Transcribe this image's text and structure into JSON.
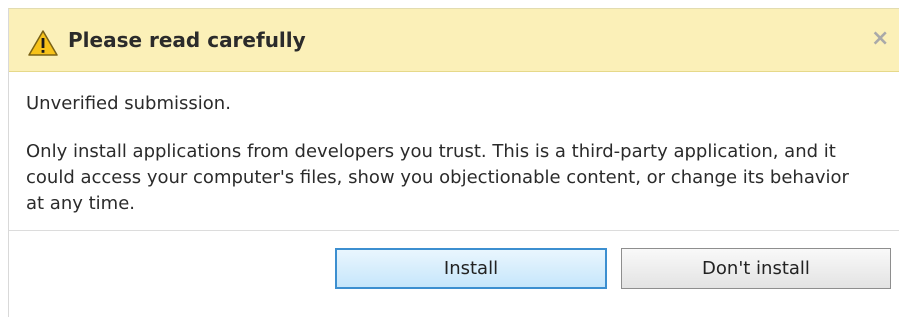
{
  "dialog": {
    "title": "Please read carefully",
    "icons": {
      "warning": "warning-triangle-icon",
      "close": "close-icon"
    },
    "close_glyph": "×",
    "subtitle": "Unverified submission.",
    "message": "Only install applications from developers you trust. This is a third-party application, and it could access your computer's files, show you objectionable content, or change its behavior at any time.",
    "buttons": {
      "install_label": "Install",
      "dont_install_label": "Don't install"
    }
  },
  "colors": {
    "header_bg": "#fbf0b8",
    "warning_yellow": "#f6c21a",
    "install_border": "#3c8fd0"
  }
}
